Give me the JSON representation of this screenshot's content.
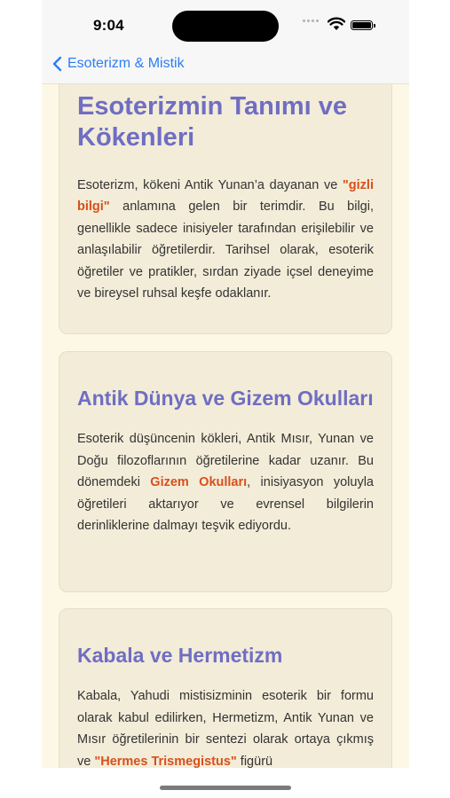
{
  "status": {
    "time": "9:04"
  },
  "nav": {
    "back_label": "Esoterizm & Mistik"
  },
  "cards": [
    {
      "title": "Esoterizmin Tanımı ve Kökenleri",
      "p_before": "Esoterizm, kökeni Antik Yunan’a dayanan ve ",
      "highlight": "\"gizli bilgi\"",
      "p_after": " anlamına gelen bir terimdir. Bu bilgi, genellikle sadece inisiyeler tarafından erişilebilir ve anlaşılabilir öğretilerdir. Tarihsel olarak, esoterik öğretiler ve pratikler, sırdan ziyade içsel deneyime ve bireysel ruhsal keşfe odaklanır."
    },
    {
      "title": "Antik Dünya ve Gizem Okulları",
      "p_before": "Esoterik düşüncenin kökleri, Antik Mısır, Yunan ve Doğu filozoflarının öğretilerine kadar uzanır. Bu dönemdeki ",
      "highlight": "Gizem Okulları",
      "p_after": ", inisiyasyon yoluyla öğretileri aktarıyor ve evrensel bilgilerin derinliklerine dalmayı teşvik ediyordu."
    },
    {
      "title": "Kabala ve Hermetizm",
      "p_before": "Kabala, Yahudi mistisizminin esoterik bir formu olarak kabul edilirken, Hermetizm, Antik Yunan ve Mısır öğretilerinin bir sentezi olarak ortaya çıkmış ve ",
      "highlight": "\"Hermes Trismegistus\"",
      "p_after": " figürü"
    }
  ]
}
